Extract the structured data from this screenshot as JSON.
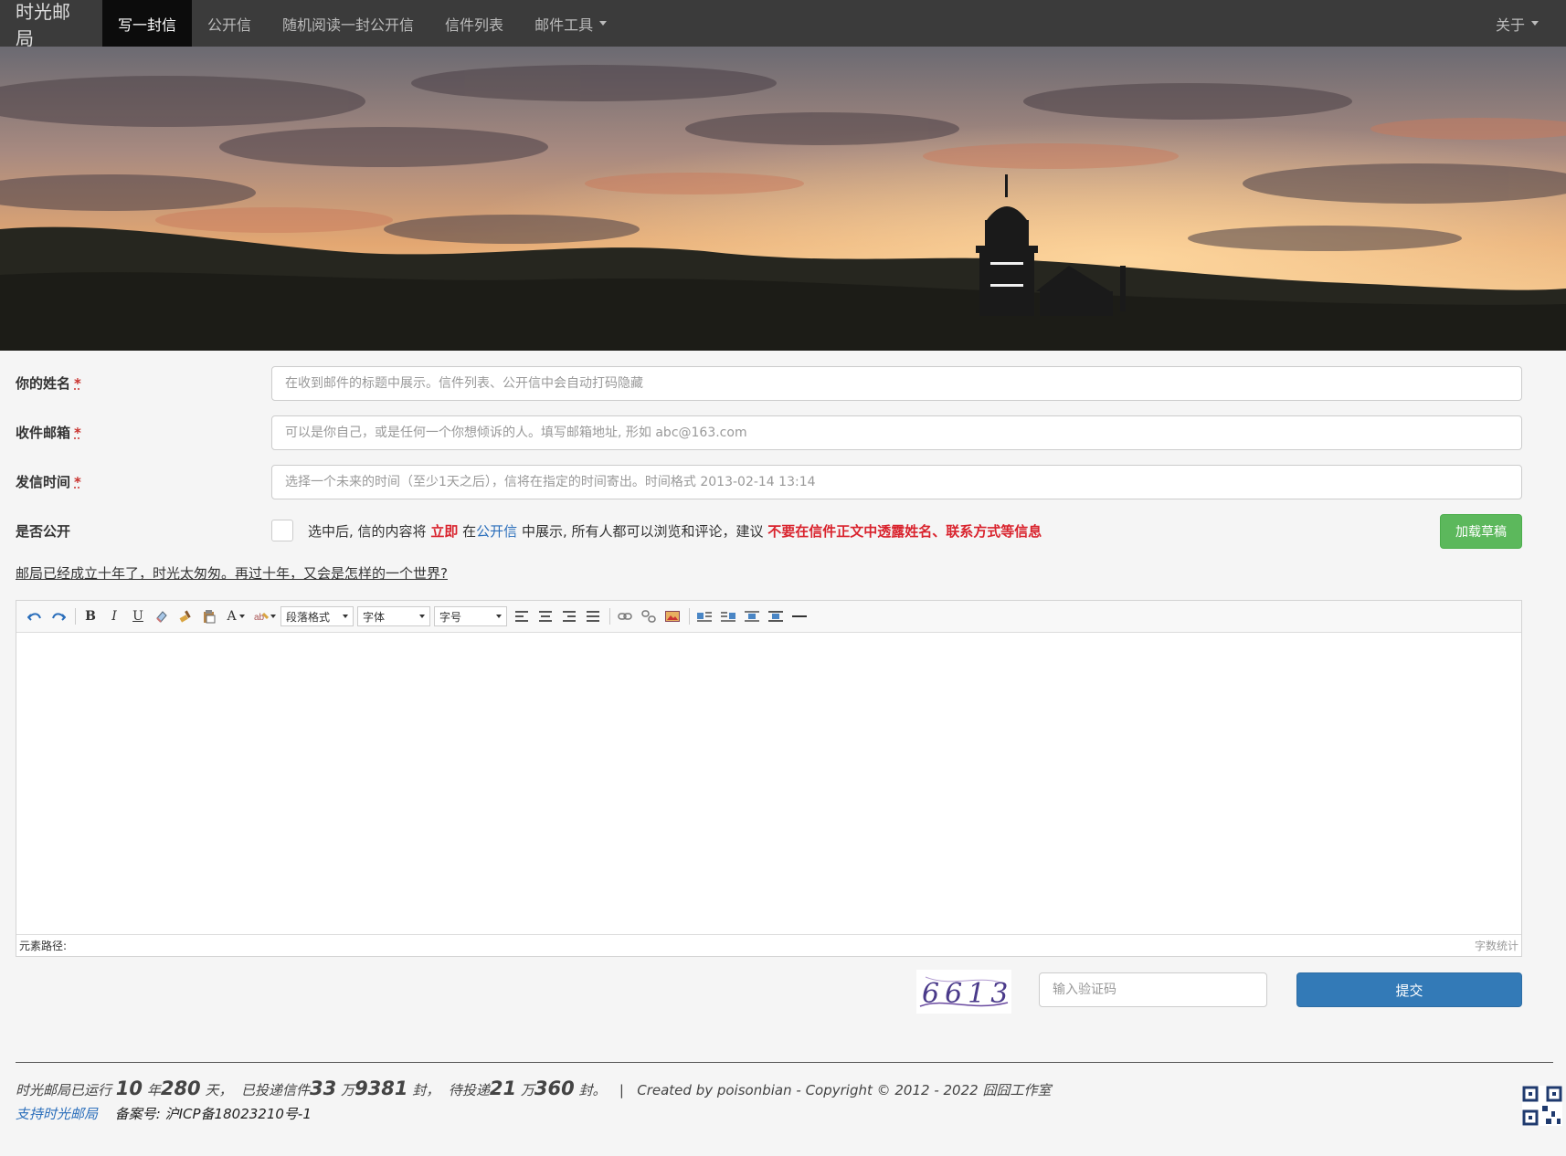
{
  "navbar": {
    "brand": "时光邮局",
    "items": [
      {
        "label": "写一封信",
        "active": true
      },
      {
        "label": "公开信",
        "active": false
      },
      {
        "label": "随机阅读一封公开信",
        "active": false
      },
      {
        "label": "信件列表",
        "active": false
      },
      {
        "label": "邮件工具",
        "active": false,
        "dropdown": true
      }
    ],
    "right": {
      "label": "关于",
      "dropdown": true
    }
  },
  "form": {
    "name": {
      "label": "你的姓名",
      "required_mark": "*",
      "placeholder": "在收到邮件的标题中展示。信件列表、公开信中会自动打码隐藏",
      "value": ""
    },
    "email": {
      "label": "收件邮箱",
      "required_mark": "*",
      "placeholder": "可以是你自己，或是任何一个你想倾诉的人。填写邮箱地址, 形如 abc@163.com",
      "value": ""
    },
    "send_time": {
      "label": "发信时间",
      "required_mark": "*",
      "placeholder": "选择一个未来的时间（至少1天之后），信将在指定的时间寄出。时间格式 2013-02-14 13:14",
      "value": ""
    },
    "public": {
      "label": "是否公开",
      "checked": false,
      "text_1": "选中后, 信的内容将",
      "text_immediately": "立即",
      "text_2": "在",
      "text_link": "公开信",
      "text_3": "中展示, 所有人都可以浏览和评论，建议",
      "text_warning": "不要在信件正文中透露姓名、联系方式等信息"
    },
    "load_draft_button": "加载草稿",
    "slogan": "邮局已经成立十年了，时光太匆匆。再过十年，又会是怎样的一个世界?"
  },
  "editor": {
    "toolbar": {
      "paragraph_select": "段落格式",
      "font_select": "字体",
      "size_select": "字号",
      "text_color_glyph": "A",
      "bold_glyph": "B",
      "italic_glyph": "I",
      "underline_glyph": "U"
    },
    "status_left": "元素路径:",
    "status_right": "字数统计"
  },
  "captcha": {
    "image_text": "6613",
    "input_placeholder": "输入验证码"
  },
  "submit_button": "提交",
  "footer": {
    "stats_prefix": "时光邮局已运行",
    "years": "10",
    "years_unit": "年",
    "days": "280",
    "days_unit": "天，",
    "delivered_prefix": "已投递信件",
    "delivered_wan": "33",
    "delivered_wan_unit": "万",
    "delivered_rest": "9381",
    "delivered_unit": "封，",
    "pending_prefix": "待投递",
    "pending_wan": "21",
    "pending_wan_unit": "万",
    "pending_rest": "360",
    "pending_unit": "封。",
    "separator": "|",
    "copyright": "Created by poisonbian - Copyright © 2012 - 2022 囧囧工作室",
    "support_link": "支持时光邮局",
    "icp": "备案号: 沪ICP备18023210号-1"
  },
  "colors": {
    "navbar_bg": "#3b3b3b",
    "navbar_active_bg": "#0c0c0c",
    "draft_button": "#5cb85c",
    "submit_button": "#337ab7",
    "warning_red": "#d9232d",
    "link_blue": "#2a6ebb"
  }
}
